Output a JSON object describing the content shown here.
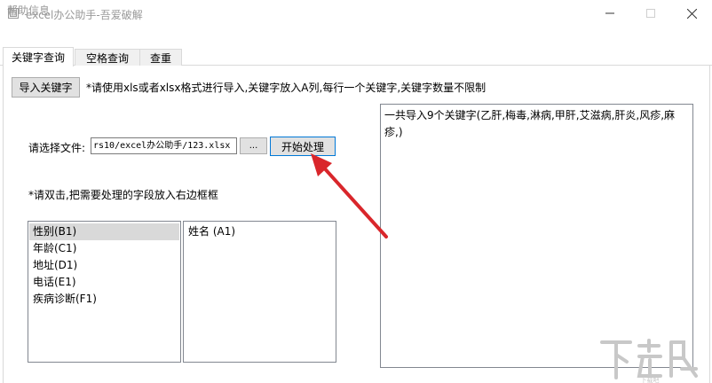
{
  "window": {
    "title": "excel办公助手-吾爱破解",
    "minimize_glyph": "—",
    "maximize_glyph": "☐",
    "close_glyph": "✕"
  },
  "menu": {
    "help": "帮助信息"
  },
  "tabs": [
    {
      "label": "关键字查询",
      "active": true
    },
    {
      "label": "空格查询",
      "active": false
    },
    {
      "label": "查重",
      "active": false
    }
  ],
  "import_button": "导入关键字",
  "instruction": "*请使用xls或者xlsx格式进行导入,关键字放入A列,每行一个关键字,关键字数量不限制",
  "file": {
    "label": "请选择文件:",
    "value": "rs10/excel办公助手/123.xlsx",
    "browse_label": "...",
    "start_label": "开始处理"
  },
  "hint": "*请双击,把需要处理的字段放入右边框框",
  "fields_list": [
    "性别(B1)",
    "年龄(C1)",
    "地址(D1)",
    "电话(E1)",
    "疾病诊断(F1)"
  ],
  "selected_list": [
    "姓名 (A1)"
  ],
  "result_text": "一共导入9个关键字(乙肝,梅毒,淋病,甲肝,艾滋病,肝炎,风疹,麻疹,)",
  "colors": {
    "arrow": "#d9262b",
    "active_border": "#0078d7",
    "selection": "#d9d9d9"
  },
  "watermark_text": "下载吧"
}
